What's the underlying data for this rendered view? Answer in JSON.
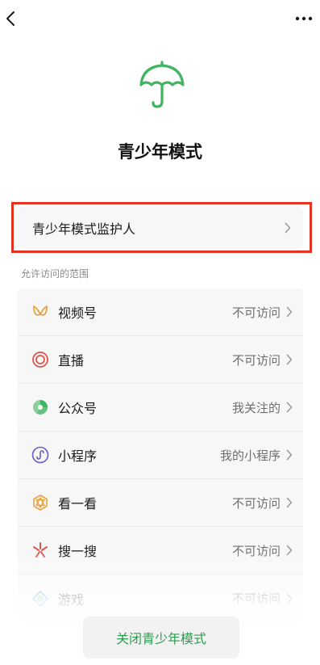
{
  "header": {
    "back_icon": "chevron-left-icon",
    "more_icon": "more-dots-icon"
  },
  "hero": {
    "icon": "umbrella-icon",
    "title": "青少年模式"
  },
  "guardian": {
    "label": "青少年模式监护人",
    "highlight_color": "#e53223"
  },
  "section": {
    "label": "允许访问的范围"
  },
  "items": [
    {
      "label": "视频号",
      "value": "不可访问",
      "icon": "channels-icon"
    },
    {
      "label": "直播",
      "value": "不可访问",
      "icon": "live-icon"
    },
    {
      "label": "公众号",
      "value": "我关注的",
      "icon": "official-account-icon"
    },
    {
      "label": "小程序",
      "value": "我的小程序",
      "icon": "mini-program-icon"
    },
    {
      "label": "看一看",
      "value": "不可访问",
      "icon": "top-stories-icon"
    },
    {
      "label": "搜一搜",
      "value": "不可访问",
      "icon": "search-icon"
    },
    {
      "label": "游戏",
      "value": "不可访问",
      "icon": "games-icon"
    }
  ],
  "footer": {
    "close_label": "关闭青少年模式"
  },
  "colors": {
    "accent_green": "#2e9b4f",
    "hero_green": "#3fb461"
  }
}
